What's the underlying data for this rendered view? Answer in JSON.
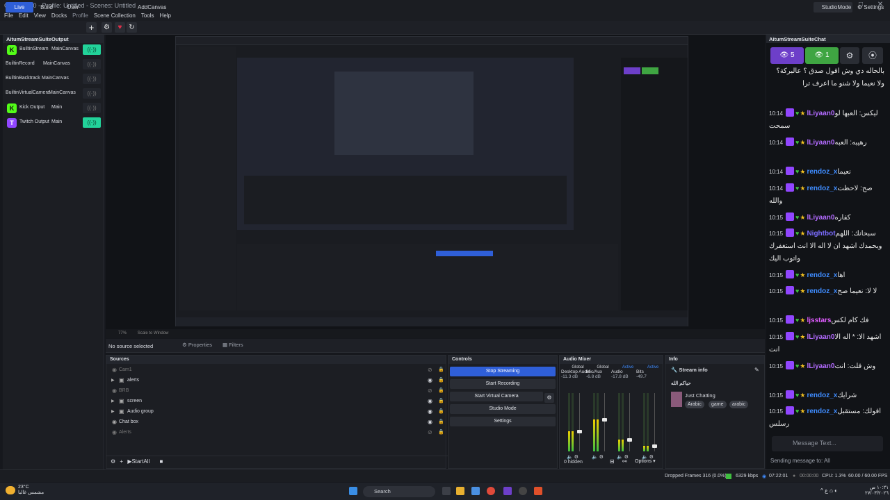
{
  "window": {
    "title": "OBS 32.1.0 - Profile: Untitled - Scenes: Untitled",
    "controls": [
      "–",
      "□",
      "✕"
    ]
  },
  "menu": [
    "File",
    "Edit",
    "View",
    "Docks",
    "Profile",
    "Scene Collection",
    "Tools",
    "Help"
  ],
  "toolbar": {
    "live": "Live",
    "build": "Build",
    "user": "User",
    "add_canvas": "AddCanvas",
    "studio_mode": "StudioMode",
    "settings": "Settings"
  },
  "outputs": {
    "title": "AitumStreamSuiteOutput",
    "rows": [
      {
        "name": "BuiltinStream",
        "canvas": "MainCanvas",
        "icon_color": "#53fc18",
        "glyph": "K",
        "active": true
      },
      {
        "name": "BuiltinRecord",
        "canvas": "MainCanvas",
        "icon_color": "",
        "glyph": "",
        "active": false
      },
      {
        "name": "BuiltinBacktrack",
        "canvas": "MainCanvas",
        "icon_color": "",
        "glyph": "",
        "active": false
      },
      {
        "name": "BuiltinVirtualCamera",
        "canvas": "MainCanvas",
        "icon_color": "",
        "glyph": "",
        "active": false
      },
      {
        "name": "Kick Output",
        "canvas": "Main",
        "icon_color": "#53fc18",
        "glyph": "K",
        "active": false
      },
      {
        "name": "Twitch Output",
        "canvas": "Main",
        "icon_color": "#9146ff",
        "glyph": "T",
        "active": true
      }
    ]
  },
  "preview": {
    "zoom": "77%",
    "scale_mode": "Scale to Window"
  },
  "properties_bar": {
    "no_source": "No source selected",
    "properties": "Properties",
    "filters": "Filters"
  },
  "sources": {
    "title": "Sources",
    "items": [
      {
        "name": "Cam1",
        "group": false,
        "dim": true
      },
      {
        "name": "alerts",
        "group": true,
        "dim": false
      },
      {
        "name": "BRB",
        "group": false,
        "dim": true
      },
      {
        "name": "screen",
        "group": true,
        "dim": false
      },
      {
        "name": "Audio group",
        "group": true,
        "dim": false
      },
      {
        "name": "Chat box",
        "group": false,
        "dim": false
      },
      {
        "name": "Alerts",
        "group": false,
        "dim": true
      }
    ],
    "start_all": "StartAll"
  },
  "controls": {
    "title": "Controls",
    "stop_streaming": "Stop Streaming",
    "start_recording": "Start Recording",
    "start_virtual_camera": "Start Virtual Camera",
    "studio_mode": "Studio Mode",
    "settings": "Settings"
  },
  "mixer": {
    "title": "Audio Mixer",
    "channels": [
      {
        "header": "Global",
        "name": "Desktop Audio",
        "db": "-11.3 dB",
        "level": 0.35
      },
      {
        "header": "Global",
        "name": "Mic/Aux",
        "db": "-6.8 dB",
        "level": 0.55
      },
      {
        "header": "Active",
        "name": "Audio",
        "db": "-17.8 dB",
        "level": 0.2
      },
      {
        "header": "Active",
        "name": "Bits",
        "db": "-49.7",
        "level": 0.1
      }
    ],
    "hidden": "0 hidden",
    "options": "Options"
  },
  "info": {
    "title": "Info",
    "stream_info": "Stream info",
    "stream_title": "حياكم الله",
    "game": "Just Chatting",
    "tags": [
      "Arabic",
      "game",
      "arabic"
    ]
  },
  "chat": {
    "title": "AitumStreamSuiteChat",
    "viewers": "5",
    "active": "1",
    "messages": [
      {
        "time": "",
        "user": "",
        "text": "بالحاله دي وش اقول صدق ؟ عالبركة؟ ولا نعيما ولا شنو ما اعرف ترا",
        "color": "#e8e8e8"
      },
      {
        "time": "10:14",
        "user": "lLiyaan0",
        "text": "ليكس: العبها لو سمحت",
        "color": "#b36bff"
      },
      {
        "time": "10:14",
        "user": "lLiyaan0",
        "text": "رهيبه: العبه",
        "color": "#b36bff"
      },
      {
        "time": "10:14",
        "user": "rendoz_x",
        "text": "نعيما",
        "color": "#3f8cff"
      },
      {
        "time": "10:14",
        "user": "rendoz_x",
        "text": "صح: لاحظت والله",
        "color": "#3f8cff"
      },
      {
        "time": "10:15",
        "user": "lLiyaan0",
        "text": "كفاره",
        "color": "#b36bff"
      },
      {
        "time": "10:15",
        "user": "Nightbot",
        "text": "سبحانك: اللهم وبحمدك اشهد ان لا اله الا انت استغفرك واتوب اليك",
        "color": "#7b6cff"
      },
      {
        "time": "10:15",
        "user": "rendoz_x",
        "text": "اها",
        "color": "#3f8cff"
      },
      {
        "time": "10:15",
        "user": "rendoz_x",
        "text": "لا لا: نعيما صح",
        "color": "#3f8cff"
      },
      {
        "time": "10:15",
        "user": "ljsstars",
        "text": "فك كام لكس",
        "color": "#e05cff"
      },
      {
        "time": "10:15",
        "user": "lLiyaan0",
        "text": "اشهد الا: * اله الا انت",
        "color": "#b36bff"
      },
      {
        "time": "10:15",
        "user": "lLiyaan0",
        "text": "وش قلت: انت",
        "color": "#b36bff"
      },
      {
        "time": "10:15",
        "user": "rendoz_x",
        "text": "شرايك",
        "color": "#3f8cff"
      },
      {
        "time": "10:15",
        "user": "rendoz_x",
        "text": "اقولك: مستقبل رسلس",
        "color": "#3f8cff"
      }
    ],
    "input_placeholder": "Message Text...",
    "sending": "Sending message to: All"
  },
  "status": {
    "dropped": "Dropped Frames 316 (0.0%)",
    "kbps": "6329 kbps",
    "live_time": "07:22:01",
    "rec_time": "00:00:00",
    "cpu": "CPU: 1.3%",
    "fps": "60.00 / 60.00 FPS"
  },
  "taskbar": {
    "weather_temp": "23°C",
    "weather_text": "مشمس غالبا",
    "search": "Search",
    "time": "١٠:٢١ ص",
    "date": "٢٧/٠٣/٢٠٢٦"
  }
}
